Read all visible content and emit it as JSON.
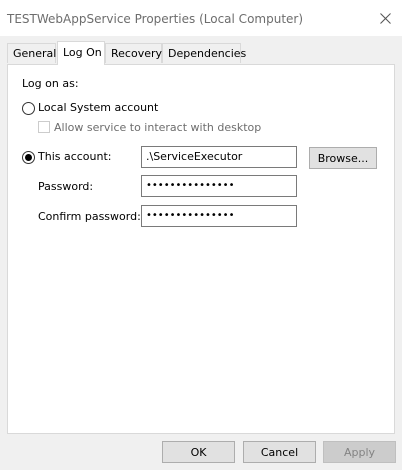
{
  "window": {
    "title": "TESTWebAppService Properties (Local Computer)",
    "close_icon": "close-icon"
  },
  "tabs": [
    {
      "label": "General",
      "active": false
    },
    {
      "label": "Log On",
      "active": true
    },
    {
      "label": "Recovery",
      "active": false
    },
    {
      "label": "Dependencies",
      "active": false
    }
  ],
  "logon": {
    "heading": "Log on as:",
    "local_system_label": "Local System account",
    "local_system_selected": false,
    "interact_desktop_label": "Allow service to interact with desktop",
    "interact_desktop_checked": false,
    "this_account_label": "This account:",
    "this_account_selected": true,
    "account_value": ".\\ServiceExecutor",
    "browse_label": "Browse...",
    "password_label": "Password:",
    "password_value": "•••••••••••••••",
    "confirm_password_label": "Confirm password:",
    "confirm_password_value": "•••••••••••••••"
  },
  "footer": {
    "ok_label": "OK",
    "cancel_label": "Cancel",
    "apply_label": "Apply",
    "apply_disabled": true
  }
}
